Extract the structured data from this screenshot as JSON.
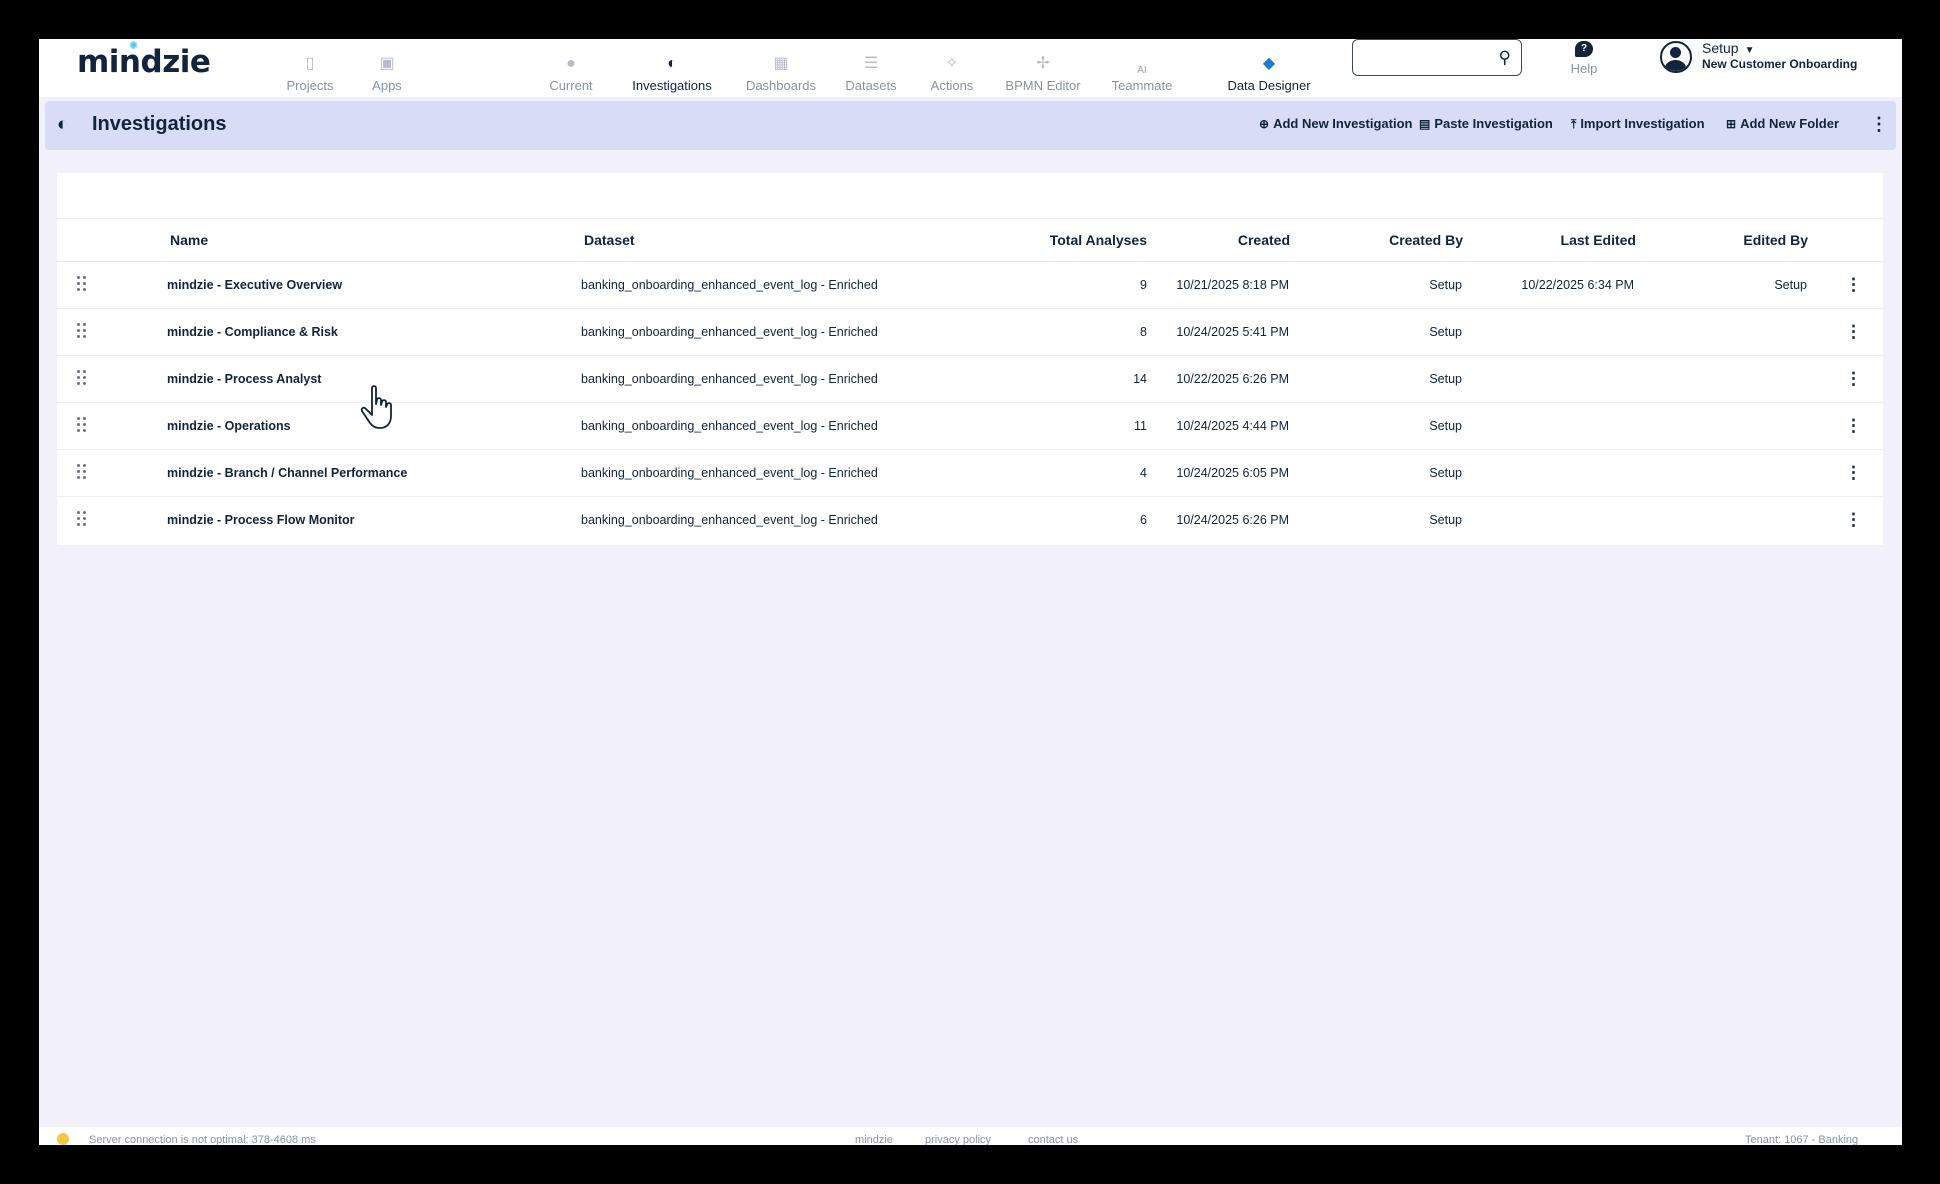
{
  "app": {
    "logo": "mindzie"
  },
  "nav": {
    "items": [
      {
        "label": "Projects",
        "icon": "document-icon"
      },
      {
        "label": "Apps",
        "icon": "apps-icon"
      },
      {
        "label": "Current",
        "icon": "location-pin-icon"
      },
      {
        "label": "Investigations",
        "icon": "investigations-icon"
      },
      {
        "label": "Dashboards",
        "icon": "dashboard-grid-icon"
      },
      {
        "label": "Datasets",
        "icon": "database-icon"
      },
      {
        "label": "Actions",
        "icon": "actions-icon"
      },
      {
        "label": "BPMN Editor",
        "icon": "bpmn-icon"
      },
      {
        "label": "Teammate",
        "prefix": "AI",
        "icon": "chat-icon"
      },
      {
        "label": "Data Designer",
        "icon": "cube-icon"
      }
    ],
    "search_placeholder": "",
    "help_label": "Help",
    "help_glyph": "?",
    "user_name": "Setup",
    "user_org": "New Customer Onboarding"
  },
  "header": {
    "title": "Investigations",
    "actions": {
      "add_new": "Add New Investigation",
      "paste": "Paste Investigation",
      "import": "Import Investigation",
      "add_folder": "Add New Folder"
    }
  },
  "table": {
    "columns": {
      "name": "Name",
      "dataset": "Dataset",
      "total_analyses": "Total Analyses",
      "created": "Created",
      "created_by": "Created By",
      "last_edited": "Last Edited",
      "edited_by": "Edited By"
    },
    "rows": [
      {
        "name": "mindzie - Executive Overview",
        "dataset": "banking_onboarding_enhanced_event_log - Enriched",
        "total": "9",
        "created": "10/21/2025 8:18 PM",
        "created_by": "Setup",
        "last_edited": "10/22/2025 6:34 PM",
        "edited_by": "Setup"
      },
      {
        "name": "mindzie - Compliance & Risk",
        "dataset": "banking_onboarding_enhanced_event_log - Enriched",
        "total": "8",
        "created": "10/24/2025 5:41 PM",
        "created_by": "Setup",
        "last_edited": "",
        "edited_by": ""
      },
      {
        "name": "mindzie - Process Analyst",
        "dataset": "banking_onboarding_enhanced_event_log - Enriched",
        "total": "14",
        "created": "10/22/2025 6:26 PM",
        "created_by": "Setup",
        "last_edited": "",
        "edited_by": ""
      },
      {
        "name": "mindzie - Operations",
        "dataset": "banking_onboarding_enhanced_event_log - Enriched",
        "total": "11",
        "created": "10/24/2025 4:44 PM",
        "created_by": "Setup",
        "last_edited": "",
        "edited_by": ""
      },
      {
        "name": "mindzie - Branch / Channel Performance",
        "dataset": "banking_onboarding_enhanced_event_log - Enriched",
        "total": "4",
        "created": "10/24/2025 6:05 PM",
        "created_by": "Setup",
        "last_edited": "",
        "edited_by": ""
      },
      {
        "name": "mindzie - Process Flow Monitor",
        "dataset": "banking_onboarding_enhanced_event_log - Enriched",
        "total": "6",
        "created": "10/24/2025 6:26 PM",
        "created_by": "Setup",
        "last_edited": "",
        "edited_by": ""
      }
    ]
  },
  "footer": {
    "status": "Server connection is not optimal: 378-4608 ms",
    "links": [
      "mindzie",
      "privacy policy",
      "contact us"
    ],
    "tenant": "Tenant: 1067 - Banking"
  },
  "colors": {
    "primary": "#12233d",
    "header_band": "#d9dcf6",
    "page_bg": "#f1f0fb",
    "accent": "#1f7ac8"
  }
}
